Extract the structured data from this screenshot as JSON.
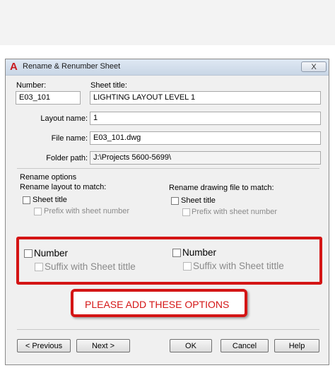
{
  "window": {
    "title": "Rename & Renumber Sheet",
    "logo_letter": "A",
    "close_label": "X"
  },
  "fields": {
    "number_label": "Number:",
    "number_value": "E03_101",
    "sheet_title_label": "Sheet title:",
    "sheet_title_value": "LIGHTING LAYOUT LEVEL 1",
    "layout_name_label": "Layout name:",
    "layout_name_value": "1",
    "file_name_label": "File name:",
    "file_name_value": "E03_101.dwg",
    "folder_path_label": "Folder path:",
    "folder_path_value": "J:\\Projects 5600-5699\\"
  },
  "rename_options": {
    "group_label": "Rename options",
    "layout_heading": "Rename layout to match:",
    "layout_sheet_title": "Sheet title",
    "layout_prefix": "Prefix with sheet number",
    "drawing_heading": "Rename drawing file to match:",
    "drawing_sheet_title": "Sheet title",
    "drawing_prefix": "Prefix with sheet number"
  },
  "proposed_options": {
    "left_number": "Number",
    "left_suffix": "Suffix with Sheet tittle",
    "right_number": "Number",
    "right_suffix": "Suffix with Sheet tittle"
  },
  "callout": {
    "text": "PLEASE ADD THESE OPTIONS"
  },
  "buttons": {
    "previous": "< Previous",
    "next": "Next >",
    "ok": "OK",
    "cancel": "Cancel",
    "help": "Help"
  },
  "colors": {
    "highlight": "#d41515",
    "dialog_bg": "#f0f0f0"
  }
}
